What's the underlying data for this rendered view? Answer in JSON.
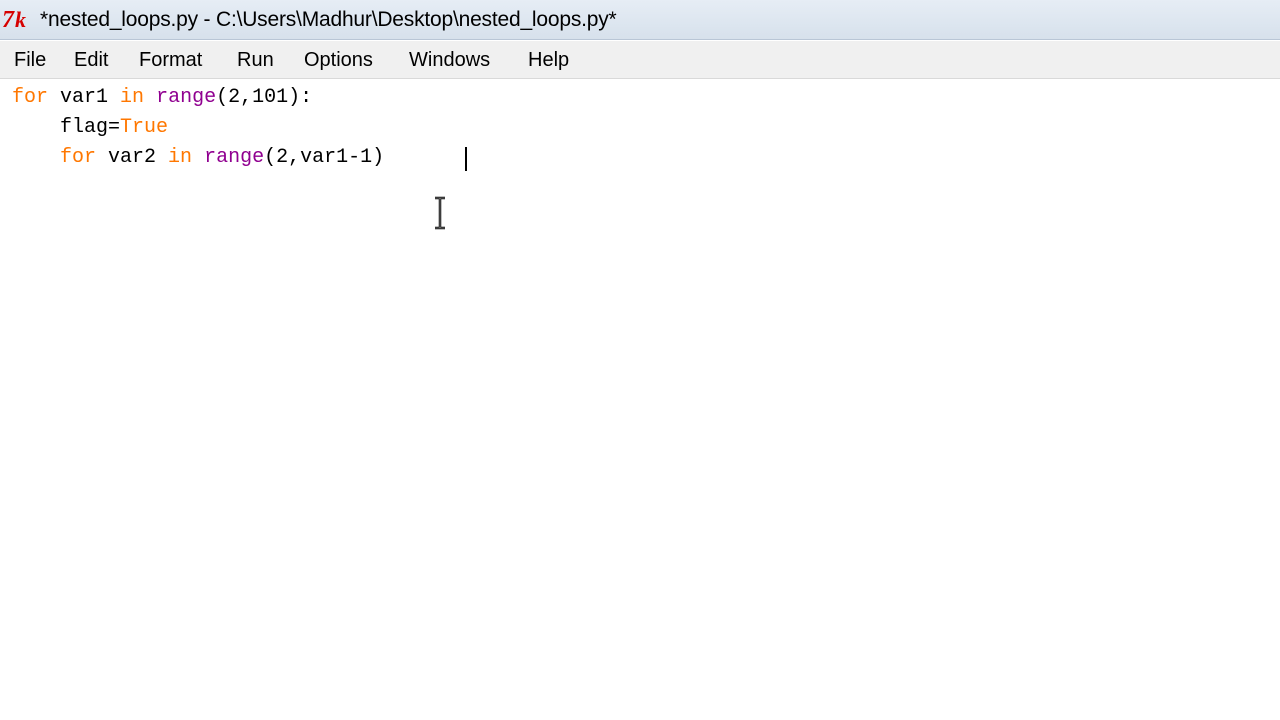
{
  "window": {
    "title": "*nested_loops.py - C:\\Users\\Madhur\\Desktop\\nested_loops.py*"
  },
  "menu": {
    "items": [
      "File",
      "Edit",
      "Format",
      "Run",
      "Options",
      "Windows",
      "Help"
    ]
  },
  "editor": {
    "lines": [
      {
        "indent": "",
        "tokens": [
          {
            "t": "for",
            "c": "kw"
          },
          {
            "t": " var1 ",
            "c": ""
          },
          {
            "t": "in",
            "c": "kw"
          },
          {
            "t": " ",
            "c": ""
          },
          {
            "t": "range",
            "c": "bi"
          },
          {
            "t": "(2,101):",
            "c": ""
          }
        ]
      },
      {
        "indent": "    ",
        "tokens": [
          {
            "t": "flag=",
            "c": ""
          },
          {
            "t": "True",
            "c": "kw"
          }
        ]
      },
      {
        "indent": "    ",
        "tokens": [
          {
            "t": "for",
            "c": "kw"
          },
          {
            "t": " var2 ",
            "c": ""
          },
          {
            "t": "in",
            "c": "kw"
          },
          {
            "t": " ",
            "c": ""
          },
          {
            "t": "range",
            "c": "bi"
          },
          {
            "t": "(2,var1-1)",
            "c": ""
          }
        ]
      }
    ]
  },
  "colors": {
    "keyword": "#ff7700",
    "builtin": "#900090",
    "text": "#000000"
  }
}
